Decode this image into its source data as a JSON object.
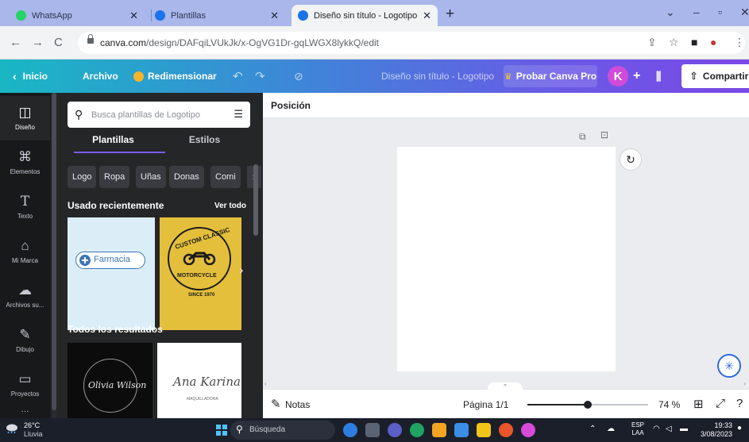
{
  "browser": {
    "tabs": [
      {
        "title": "WhatsApp",
        "close": "✕",
        "color": "#25d366",
        "active": false
      },
      {
        "title": "Plantillas",
        "close": "✕",
        "color": "#1a73e8",
        "active": false
      },
      {
        "title": "Diseño sin título - Logotipo",
        "close": "✕",
        "color": "#1a73e8",
        "active": true
      }
    ],
    "new_tab": "+",
    "url_domain": "canva.com",
    "url_path": "/design/DAFqiLVUkJk/x-OgVG1Dr-gqLWGX8lykkQ/edit"
  },
  "header": {
    "home": "Inicio",
    "file": "Archivo",
    "resize": "Redimensionar",
    "doc_title": "Diseño sin título - Logotipo",
    "try_pro": "Probar Canva Pro",
    "avatar_initial": "K",
    "add": "+",
    "share": "Compartir"
  },
  "rail": {
    "items": [
      {
        "label": "Diseño",
        "icon": "design-icon",
        "active": true
      },
      {
        "label": "Elementos",
        "icon": "elements-icon",
        "active": false
      },
      {
        "label": "Texto",
        "icon": "text-icon",
        "active": false
      },
      {
        "label": "Mi Marca",
        "icon": "brand-icon",
        "active": false
      },
      {
        "label": "Archivos su...",
        "icon": "uploads-icon",
        "active": false
      },
      {
        "label": "Dibujo",
        "icon": "draw-icon",
        "active": false
      },
      {
        "label": "Proyectos",
        "icon": "folder-icon",
        "active": false
      }
    ]
  },
  "panel": {
    "search_placeholder": "Busca plantillas de Logotipo",
    "tabs": [
      "Plantillas",
      "Estilos"
    ],
    "chips": [
      "Logo",
      "Ropa",
      "Uñas",
      "Donas",
      "Comi"
    ],
    "recent_heading": "Usado recientemente",
    "see_all": "Ver todo",
    "results_heading": "Todos los resultados",
    "templates": {
      "farmacia": "Farmacia",
      "moto_top": "CUSTOM CLASSIC",
      "moto_bottom": "MOTORCYCLE",
      "moto_since": "SINCE 1970",
      "olivia": "Olivia Wilson",
      "anne": "Ana Karina",
      "anne_sub": "MAQUILLADORA"
    }
  },
  "editor": {
    "position_label": "Posición",
    "notes": "Notas",
    "page": "Página 1/1",
    "zoom": "74 %",
    "zoom_fraction": 0.5
  },
  "taskbar": {
    "temperature": "26°C",
    "weather": "Lluvia",
    "search": "Búsqueda",
    "lang_top": "ESP",
    "lang_bottom": "LAA",
    "time": "19:33",
    "date": "3/08/2023"
  }
}
